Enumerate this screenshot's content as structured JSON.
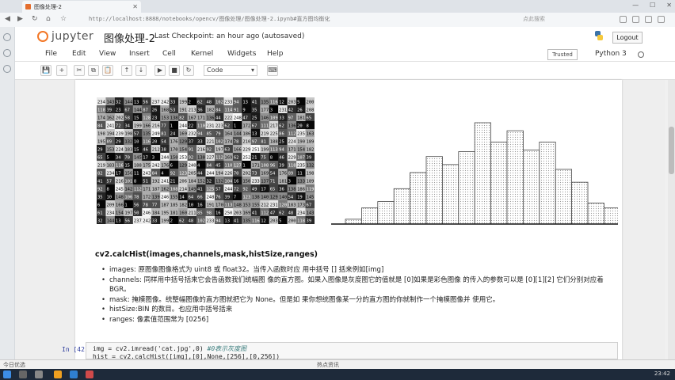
{
  "browser": {
    "tab_title": "图像处理-2",
    "url": "http://localhost:8888/notebooks/opencv/图像处理/图像处理-2.ipynb#直方图均衡化",
    "search_placeholder": "点此搜索"
  },
  "jupyter": {
    "logo_text": "jupyter",
    "notebook_name": "图像处理-2",
    "checkpoint": "Last Checkpoint: an hour ago (autosaved)",
    "logout_label": "Logout",
    "menu": [
      "File",
      "Edit",
      "View",
      "Insert",
      "Cell",
      "Kernel",
      "Widgets",
      "Help"
    ],
    "trusted_label": "Trusted",
    "kernel_name": "Python 3",
    "toolbar": {
      "save": "💾",
      "add": "+",
      "cut": "✂",
      "copy": "⧉",
      "paste": "📋",
      "up": "↑",
      "down": "↓",
      "run": "▶",
      "stop": "■",
      "restart": "↻",
      "cell_type": "Code",
      "keyboard": "⌨"
    }
  },
  "pixel_grid_values": [
    "234",
    "143",
    "32",
    "144",
    "13",
    "56",
    "237",
    "242",
    "33",
    "199",
    "2",
    "62",
    "48",
    "102",
    "233",
    "94",
    "13",
    "41",
    "135",
    "116",
    "12",
    "203",
    "5",
    "200",
    "118",
    "39",
    "23",
    "67",
    "144",
    "87",
    "26",
    "168",
    "53",
    "191",
    "213",
    "36",
    "182",
    "84",
    "114",
    "91",
    "9",
    "35",
    "177",
    "3",
    "231",
    "42",
    "26",
    "208",
    "174",
    "162",
    "202",
    "58",
    "15",
    "128",
    "23",
    "153",
    "138",
    "82",
    "167",
    "171",
    "136",
    "44",
    "222",
    "248",
    "47",
    "25",
    "146",
    "109",
    "33",
    "97",
    "181",
    "65",
    "84",
    "241",
    "72",
    "34",
    "199",
    "166",
    "216",
    "77",
    "1",
    "244",
    "22",
    "110",
    "231",
    "223",
    "62",
    "1",
    "172",
    "67",
    "111",
    "217",
    "62",
    "136",
    "20",
    "8",
    "198",
    "194",
    "239",
    "198",
    "57",
    "135",
    "249",
    "81",
    "24",
    "169",
    "232",
    "94",
    "85",
    "79",
    "164",
    "144",
    "186",
    "13",
    "219",
    "225",
    "86",
    "112",
    "235",
    "163",
    "195",
    "89",
    "29",
    "132",
    "10",
    "116",
    "20",
    "54",
    "176",
    "129",
    "37",
    "33",
    "221",
    "102",
    "174",
    "78",
    "210",
    "97",
    "81",
    "188",
    "25",
    "224",
    "190",
    "189",
    "29",
    "153",
    "224",
    "183",
    "15",
    "46",
    "212",
    "38",
    "170",
    "154",
    "91",
    "216",
    "92",
    "197",
    "63",
    "166",
    "229",
    "251",
    "199",
    "113",
    "94",
    "171",
    "154",
    "182",
    "65",
    "5",
    "34",
    "70",
    "145",
    "17",
    "3",
    "244",
    "150",
    "253",
    "92",
    "130",
    "227",
    "112",
    "169",
    "62",
    "252",
    "21",
    "75",
    "8",
    "46",
    "229",
    "107",
    "39",
    "219",
    "183",
    "116",
    "15",
    "188",
    "175",
    "242",
    "176",
    "6",
    "129",
    "240",
    "4",
    "84",
    "45",
    "110",
    "127",
    "1",
    "171",
    "108",
    "96",
    "39",
    "118",
    "235",
    "132",
    "82",
    "234",
    "17",
    "156",
    "11",
    "243",
    "84",
    "4",
    "92",
    "123",
    "205",
    "44",
    "244",
    "194",
    "226",
    "70",
    "202",
    "73",
    "169",
    "54",
    "176",
    "89",
    "11",
    "198",
    "41",
    "57",
    "216",
    "101",
    "8",
    "51",
    "192",
    "241",
    "21",
    "206",
    "184",
    "152",
    "32",
    "132",
    "104",
    "16",
    "150",
    "233",
    "137",
    "71",
    "181",
    "3",
    "133",
    "189",
    "92",
    "8",
    "245",
    "142",
    "112",
    "171",
    "187",
    "162",
    "108",
    "214",
    "149",
    "41",
    "125",
    "57",
    "244",
    "72",
    "92",
    "49",
    "17",
    "65",
    "36",
    "138",
    "186",
    "119",
    "35",
    "10",
    "148",
    "106",
    "78",
    "172",
    "139",
    "246",
    "155",
    "14",
    "64",
    "66",
    "248",
    "76",
    "39",
    "7",
    "123",
    "138",
    "140",
    "129",
    "140",
    "54",
    "19",
    "145",
    "6",
    "209",
    "166",
    "1",
    "56",
    "78",
    "77",
    "187",
    "185",
    "182",
    "10",
    "16",
    "191",
    "170",
    "113",
    "148",
    "153",
    "155",
    "212",
    "231",
    "120",
    "183",
    "173",
    "67",
    "61",
    "234",
    "154",
    "197",
    "50",
    "246",
    "184",
    "195",
    "181",
    "160",
    "211",
    "85",
    "98",
    "16",
    "250",
    "203",
    "169",
    "41",
    "112",
    "47",
    "62",
    "48"
  ],
  "histogram": {
    "values": [
      3,
      10,
      14,
      22,
      32,
      42,
      37,
      45,
      63,
      51,
      58,
      46,
      51,
      34,
      26,
      13,
      10,
      3
    ]
  },
  "markdown": {
    "title": "cv2.calcHist(images,channels,mask,histSize,ranges)",
    "items": [
      "images: 原图像图像格式为 uint8 或 float32。当传入函数时应 用中括号 [] 括来例如[img]",
      "channels: 同样用中括号括来它会告函数我们统幅图 像的直方图。如果入图像是灰度图它的值就是 [0]如果是彩色图像 的传入的参数可以是 [0][1][2] 它们分别对应着 BGR。",
      "mask: 掩模图像。统整幅图像的直方图就把它为 None。但是如 果你想统图像某一分的直方图的你就制作一个掩模图像并 使用它。",
      "histSize:BIN 的数目。也应用中括号括来",
      "ranges: 像素值范围常为 [0256]"
    ]
  },
  "code_cell": {
    "prompt": "In [42]:",
    "line1_code": "img = cv2.imread('cat.jpg',0) ",
    "line1_comment": "#0表示灰度图",
    "line2_code": "hist = cv2.calcHist([img],[0],None,[256],[0,256])"
  },
  "statusbar": {
    "left_text": "今日优选",
    "center_text": "热点资讯"
  },
  "taskbar": {
    "clock": "23:42"
  }
}
